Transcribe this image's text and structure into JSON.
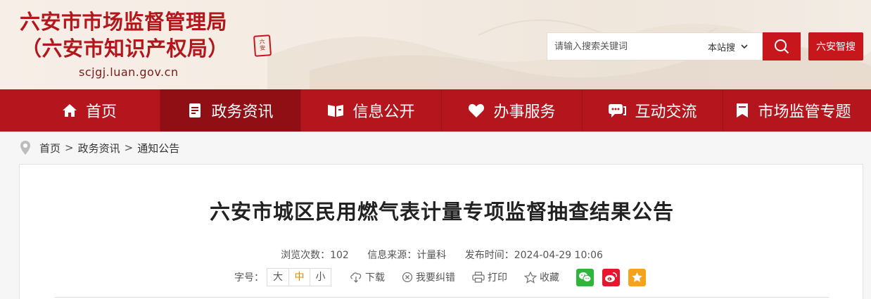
{
  "header": {
    "title_line1": "六安市市场监督管理局",
    "title_line2": "（六安市知识产权局）",
    "domain": "scjgj.luan.gov.cn",
    "seal_text": "六安",
    "search": {
      "placeholder": "请输入搜索关键词",
      "scope": "本站搜"
    },
    "zhisou_label": "六安智搜"
  },
  "nav": {
    "items": [
      {
        "label": "首页",
        "icon": "home-icon"
      },
      {
        "label": "政务资讯",
        "icon": "document-icon"
      },
      {
        "label": "信息公开",
        "icon": "open-book-icon"
      },
      {
        "label": "办事服务",
        "icon": "heart-icon"
      },
      {
        "label": "互动交流",
        "icon": "chat-icon"
      },
      {
        "label": "市场监管专题",
        "icon": "bookmark-icon"
      }
    ],
    "active_index": 1
  },
  "breadcrumb": {
    "items": [
      "首页",
      "政务资讯",
      "通知公告"
    ],
    "separator": ">"
  },
  "article": {
    "title": "六安市城区民用燃气表计量专项监督抽查结果公告",
    "meta": {
      "views": "浏览次数：102",
      "source": "信息来源：计量科",
      "published": "发布时间：2024-04-29 10:06"
    },
    "tools": {
      "font_label": "字号：",
      "font_sizes": [
        "大",
        "中",
        "小"
      ],
      "selected_font": "中",
      "download": "下载",
      "report_error": "我要纠错",
      "print": "打印",
      "favorite": "收藏"
    }
  },
  "colors": {
    "brand_red": "#b5161d",
    "nav_active": "#8f0f14",
    "wechat": "#2fb53b",
    "weibo": "#e6162d",
    "qzone": "#f7a21b"
  }
}
